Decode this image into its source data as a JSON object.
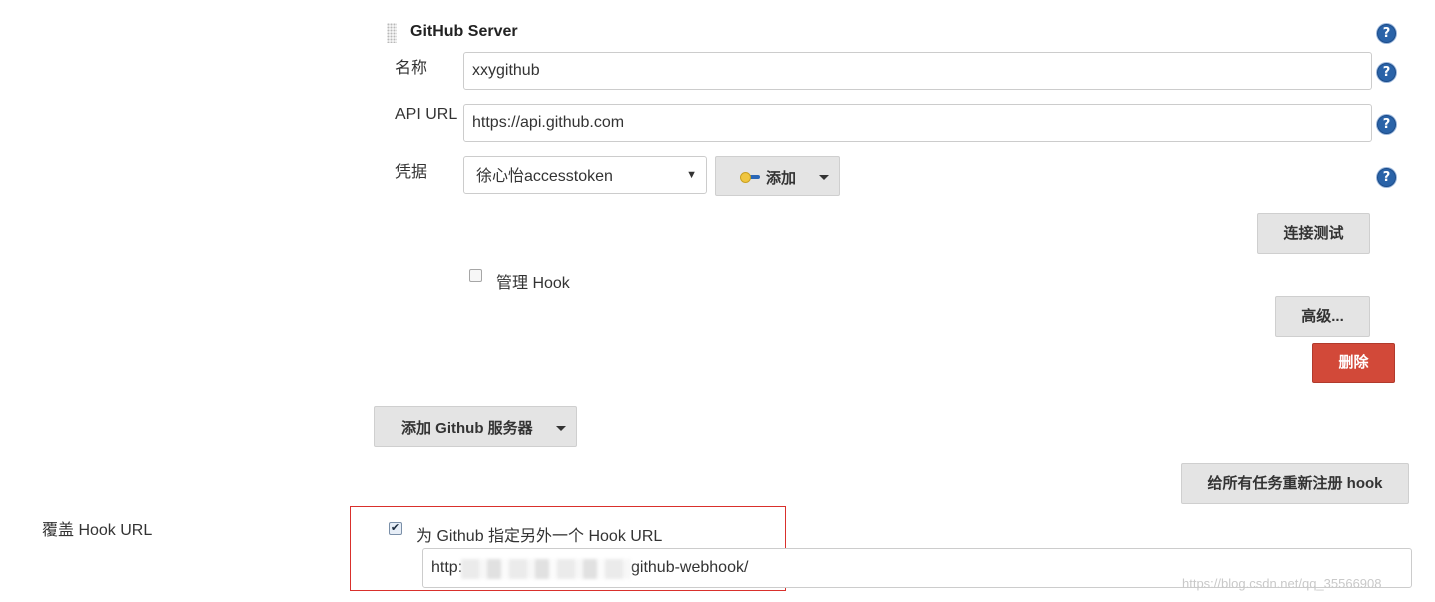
{
  "server": {
    "title": "GitHub Server",
    "name_label": "名称",
    "name_value": "xxygithub",
    "api_label": "API URL",
    "api_value": "https://api.github.com",
    "cred_label": "凭据",
    "cred_value": "徐心怡accesstoken",
    "add_label": "添加",
    "test_button": "连接测试",
    "manage_hook_label": "管理 Hook",
    "manage_hook_checked": false,
    "advanced_button": "高级...",
    "delete_button": "删除",
    "help_icon": "?"
  },
  "add_server_button": "添加 Github 服务器",
  "reregister_button": "给所有任务重新注册 hook",
  "override": {
    "label": "覆盖 Hook URL",
    "checkbox_label": "为 Github 指定另外一个 Hook URL",
    "checked": true,
    "url_prefix": "http:",
    "url_suffix": "github-webhook/"
  },
  "watermark": "https://blog.csdn.net/qq_35566908",
  "colors": {
    "delete_bg": "#d24939",
    "help_icon": "#2a63a8",
    "highlight_border": "#d9302c"
  }
}
